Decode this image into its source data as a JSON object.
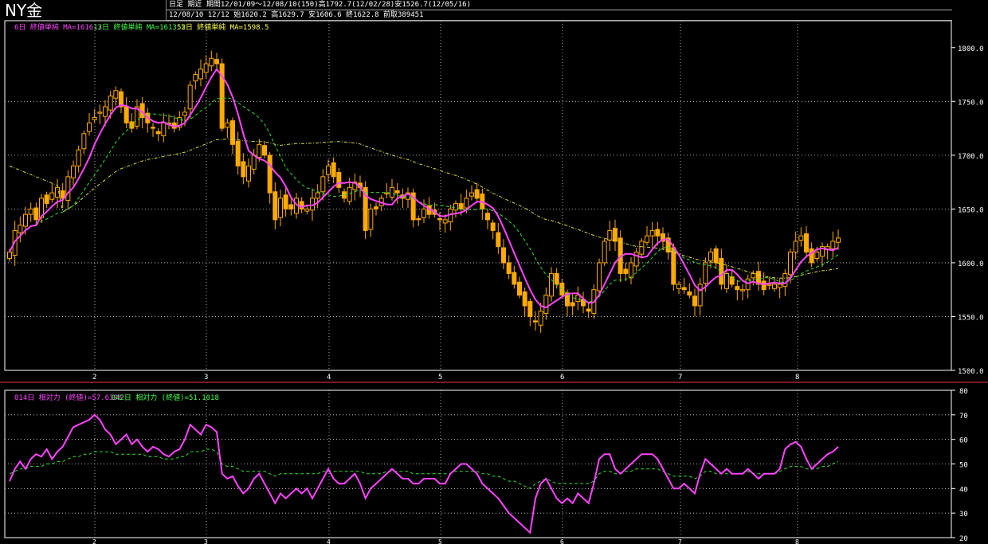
{
  "header": {
    "instrument": "NY金",
    "line1": "日足 期近 期間12/01/09～12/08/10(150)高1792.7(12/02/28)安1526.7(12/05/16)",
    "line2": "12/08/10 12/12 始1620.2 高1629.7 安1606.6 終1622.8 前取389451"
  },
  "price_legend": [
    {
      "text": "6日 終値単純 MA=1616.2",
      "color": "#ff44ff"
    },
    {
      "text": "13日 終値単純 MA=1613.5",
      "color": "#44ff44"
    },
    {
      "text": "52日 終値単純 MA=1598.5",
      "color": "#ffff44"
    }
  ],
  "rsi_legend": [
    {
      "text": "014日 相対力 (終値)=57.6398",
      "color": "#ff44ff"
    },
    {
      "text": "042日 相対力 (終値)=51.1018",
      "color": "#44ff44"
    }
  ],
  "colors": {
    "candle": "#ffaa00",
    "bg": "#000000",
    "grid": "#dddddd",
    "ma6": "#ff44ff",
    "ma13": "#33dd33",
    "ma52": "#dddd44",
    "rsi14": "#ff44ff",
    "rsi42": "#33dd33",
    "border": "#ff3333"
  },
  "chart_data": [
    {
      "type": "candlestick",
      "x_ticks": [
        "2",
        "3",
        "4",
        "5",
        "6",
        "7",
        "8"
      ],
      "y_ticks": [
        "1800.0",
        "1750.0",
        "1700.0",
        "1650.0",
        "1600.0",
        "1550.0",
        "1500.0"
      ],
      "ylim": [
        1500,
        1825
      ],
      "closes": [
        1610,
        1630,
        1635,
        1645,
        1650,
        1640,
        1660,
        1655,
        1665,
        1670,
        1660,
        1680,
        1690,
        1705,
        1720,
        1730,
        1735,
        1740,
        1745,
        1755,
        1760,
        1745,
        1730,
        1725,
        1745,
        1735,
        1730,
        1725,
        1720,
        1730,
        1730,
        1725,
        1735,
        1740,
        1765,
        1775,
        1780,
        1785,
        1790,
        1785,
        1725,
        1730,
        1710,
        1690,
        1680,
        1690,
        1700,
        1710,
        1700,
        1665,
        1640,
        1660,
        1650,
        1650,
        1660,
        1650,
        1650,
        1660,
        1665,
        1680,
        1690,
        1680,
        1670,
        1660,
        1670,
        1675,
        1670,
        1630,
        1650,
        1650,
        1660,
        1665,
        1670,
        1665,
        1660,
        1665,
        1640,
        1640,
        1650,
        1645,
        1645,
        1640,
        1640,
        1650,
        1655,
        1650,
        1660,
        1665,
        1660,
        1650,
        1640,
        1630,
        1615,
        1600,
        1590,
        1580,
        1570,
        1560,
        1550,
        1545,
        1555,
        1570,
        1590,
        1580,
        1570,
        1560,
        1560,
        1570,
        1560,
        1555,
        1575,
        1600,
        1620,
        1630,
        1620,
        1590,
        1590,
        1600,
        1610,
        1620,
        1625,
        1630,
        1625,
        1620,
        1610,
        1580,
        1580,
        1575,
        1570,
        1560,
        1580,
        1600,
        1610,
        1600,
        1580,
        1590,
        1580,
        1575,
        1575,
        1585,
        1590,
        1580,
        1575,
        1580,
        1580,
        1580,
        1590,
        1610,
        1620,
        1625,
        1610,
        1600,
        1610,
        1615,
        1615,
        1620,
        1623
      ]
    },
    {
      "type": "line",
      "ylim": [
        20,
        80
      ],
      "y_ticks": [
        "80",
        "70",
        "60",
        "50",
        "40",
        "30",
        "20"
      ],
      "series": [
        {
          "name": "014日 相対力 (終値)",
          "values": [
            43,
            48,
            51,
            48,
            52,
            54,
            53,
            56,
            52,
            55,
            57,
            61,
            65,
            66,
            67,
            68,
            70,
            68,
            64,
            62,
            58,
            60,
            62,
            58,
            60,
            57,
            55,
            57,
            56,
            54,
            53,
            55,
            56,
            60,
            66,
            64,
            62,
            66,
            65,
            63,
            46,
            44,
            45,
            41,
            38,
            40,
            44,
            46,
            42,
            38,
            34,
            38,
            36,
            38,
            40,
            38,
            40,
            36,
            40,
            44,
            48,
            44,
            42,
            42,
            44,
            46,
            42,
            36,
            40,
            42,
            44,
            46,
            48,
            46,
            44,
            44,
            42,
            42,
            44,
            44,
            44,
            42,
            42,
            46,
            48,
            50,
            50,
            48,
            46,
            42,
            40,
            38,
            36,
            33,
            30,
            28,
            26,
            24,
            22,
            36,
            42,
            44,
            40,
            36,
            34,
            36,
            34,
            38,
            36,
            34,
            42,
            52,
            54,
            54,
            48,
            46,
            48,
            50,
            52,
            54,
            54,
            54,
            52,
            48,
            44,
            40,
            40,
            42,
            40,
            38,
            46,
            52,
            50,
            48,
            46,
            48,
            46,
            46,
            46,
            48,
            46,
            44,
            46,
            46,
            46,
            48,
            56,
            58,
            59,
            57,
            52,
            48,
            50,
            52,
            54,
            55,
            57
          ]
        },
        {
          "name": "042日 相対力 (終値)",
          "values": [
            46,
            47,
            48,
            48,
            49,
            49,
            49,
            50,
            50,
            51,
            51,
            52,
            53,
            53,
            54,
            54,
            55,
            55,
            55,
            55,
            54,
            54,
            54,
            54,
            54,
            54,
            53,
            53,
            53,
            52,
            52,
            52,
            53,
            53,
            55,
            55,
            55,
            56,
            56,
            55,
            50,
            49,
            49,
            48,
            47,
            47,
            47,
            47,
            47,
            46,
            45,
            46,
            46,
            46,
            46,
            46,
            46,
            46,
            46,
            47,
            47,
            47,
            47,
            47,
            47,
            47,
            47,
            46,
            46,
            46,
            46,
            47,
            47,
            47,
            47,
            47,
            46,
            46,
            46,
            46,
            46,
            46,
            46,
            46,
            47,
            47,
            47,
            47,
            47,
            46,
            46,
            45,
            45,
            44,
            43,
            43,
            42,
            41,
            40,
            42,
            43,
            44,
            43,
            42,
            42,
            42,
            42,
            42,
            42,
            42,
            43,
            46,
            47,
            47,
            46,
            46,
            47,
            47,
            48,
            48,
            48,
            48,
            48,
            47,
            46,
            45,
            45,
            45,
            45,
            44,
            45,
            47,
            47,
            46,
            46,
            46,
            46,
            46,
            46,
            47,
            46,
            46,
            46,
            46,
            46,
            47,
            48,
            49,
            49,
            49,
            48,
            48,
            48,
            49,
            49,
            50,
            51
          ]
        }
      ]
    }
  ]
}
